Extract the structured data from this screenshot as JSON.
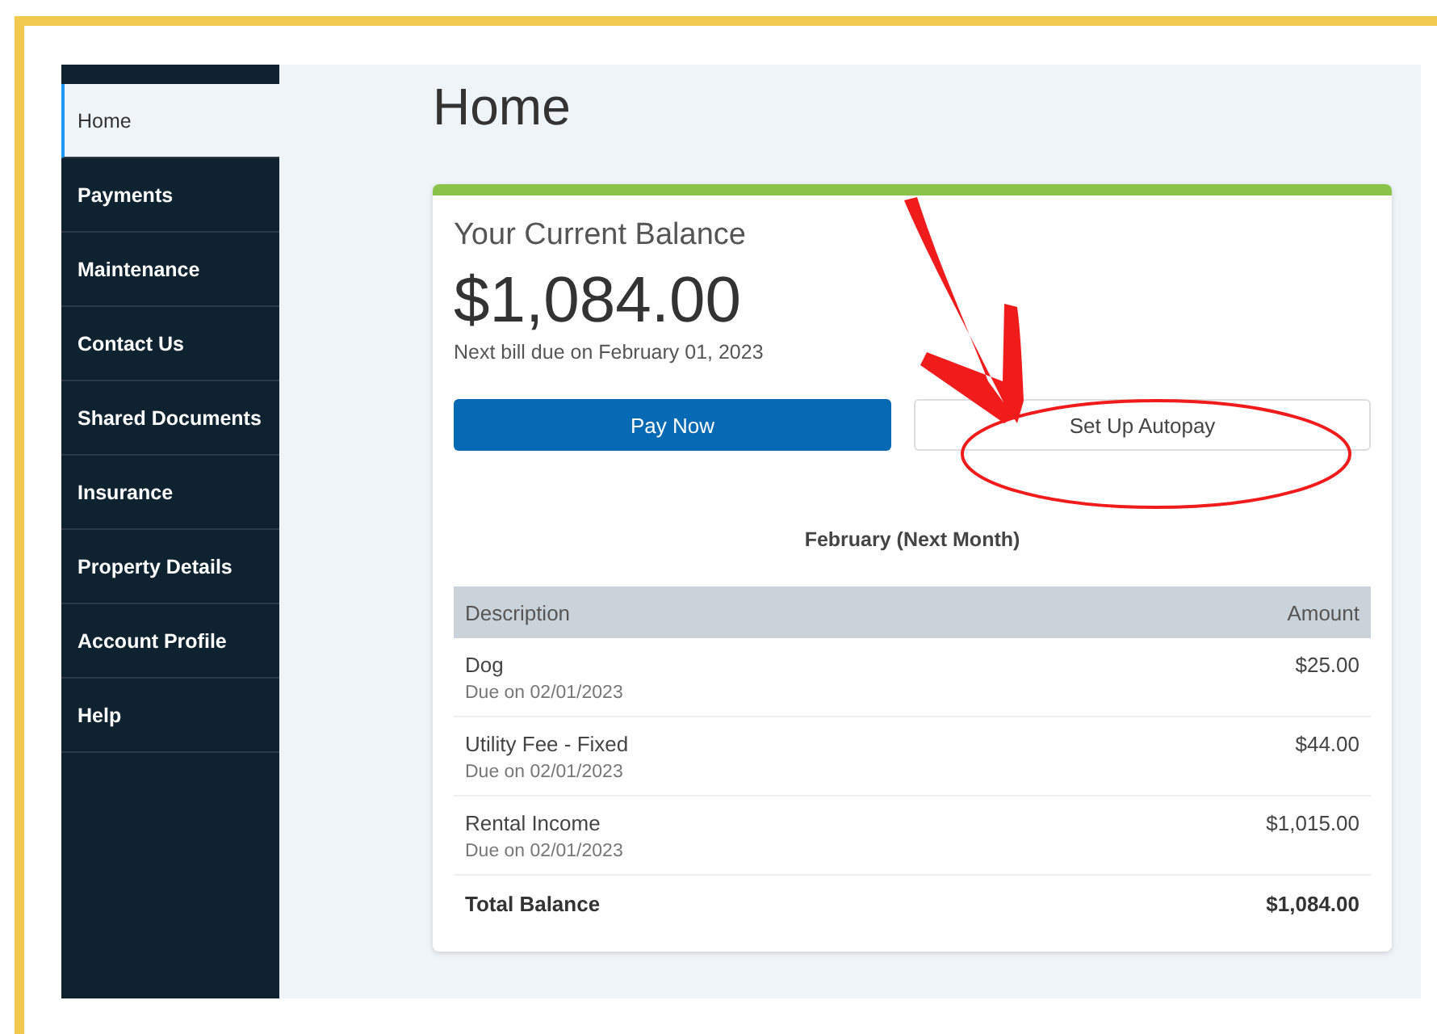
{
  "sidebar": {
    "items": [
      {
        "label": "Home",
        "selected": true
      },
      {
        "label": "Payments",
        "selected": false
      },
      {
        "label": "Maintenance",
        "selected": false
      },
      {
        "label": "Contact Us",
        "selected": false
      },
      {
        "label": "Shared Documents",
        "selected": false
      },
      {
        "label": "Insurance",
        "selected": false
      },
      {
        "label": "Property Details",
        "selected": false
      },
      {
        "label": "Account Profile",
        "selected": false
      },
      {
        "label": "Help",
        "selected": false
      }
    ]
  },
  "page_title": "Home",
  "balance_card": {
    "heading": "Your Current Balance",
    "amount": "$1,084.00",
    "next_bill": "Next bill due on February 01, 2023",
    "buttons": [
      {
        "label": "Pay Now",
        "kind": "primary"
      },
      {
        "label": "Set Up Autopay",
        "kind": "secondary"
      }
    ],
    "period": "February (Next Month)",
    "table": {
      "columns": [
        "Description",
        "Amount"
      ],
      "rows": [
        {
          "description": "Dog",
          "due": "Due on 02/01/2023",
          "amount": "$25.00"
        },
        {
          "description": "Utility Fee - Fixed",
          "due": "Due on 02/01/2023",
          "amount": "$44.00"
        },
        {
          "description": "Rental Income",
          "due": "Due on 02/01/2023",
          "amount": "$1,015.00"
        }
      ],
      "total": {
        "label": "Total Balance",
        "amount": "$1,084.00"
      }
    }
  }
}
